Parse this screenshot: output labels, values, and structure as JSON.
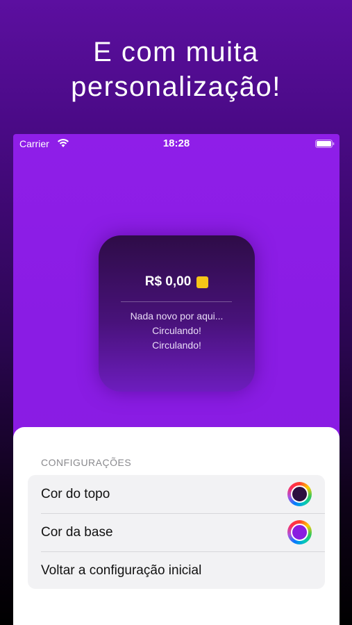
{
  "headline": {
    "line1": "E com muita",
    "line2": "personalização!"
  },
  "status_bar": {
    "carrier": "Carrier",
    "time": "18:28",
    "wifi_icon": "wifi-icon",
    "battery_icon": "battery-icon"
  },
  "widget": {
    "balance": "R$ 0,00",
    "coin_icon": "coin-icon",
    "coin_color": "#f5c518",
    "messages": [
      "Nada novo por aqui...",
      "Circulando!",
      "Circulando!"
    ]
  },
  "settings": {
    "section_title": "CONFIGURAÇÕES",
    "rows": [
      {
        "label": "Cor do topo",
        "color": "#2d0f40"
      },
      {
        "label": "Cor da base",
        "color": "#8a1ee0"
      },
      {
        "label": "Voltar a configuração inicial"
      }
    ]
  },
  "colors": {
    "accent_purple": "#8f1ee8",
    "sheet_background": "#ffffff",
    "list_background": "#f2f2f4"
  }
}
